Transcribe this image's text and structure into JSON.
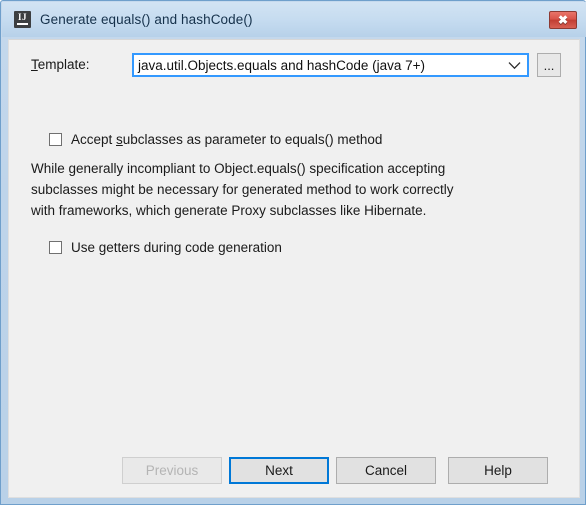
{
  "window": {
    "title": "Generate equals() and hashCode()",
    "icon": "intellij-idea-icon",
    "close_label": "✖"
  },
  "form": {
    "template": {
      "label_prefix": "T",
      "label_rest": "emplate:",
      "value": "java.util.Objects.equals and hashCode (java 7+)",
      "browse_label": "...",
      "arrow_icon": "chevron-down-icon"
    },
    "checkboxes": [
      {
        "id": "accept-subclasses",
        "pre": "Accept ",
        "mnemonic": "s",
        "post": "ubclasses as parameter to equals() method",
        "checked": false
      },
      {
        "id": "use-getters",
        "pre": "Use ",
        "mnemonic": "g",
        "post": "etters during code generation",
        "checked": false
      }
    ],
    "description_lines": [
      "While generally incompliant to Object.equals() specification accepting",
      "subclasses might be necessary for generated method to work correctly",
      "with frameworks, which generate Proxy subclasses like Hibernate."
    ]
  },
  "buttons": {
    "previous": "Previous",
    "next": "Next",
    "cancel": "Cancel",
    "help": "Help"
  },
  "colors": {
    "focus_blue": "#0078d7",
    "combo_focus_blue": "#3399ff",
    "titlebar_blue": "#c6dcf0",
    "panel_gray": "#f0f0f0",
    "button_gray": "#e1e1e1",
    "close_red": "#d9544a"
  }
}
